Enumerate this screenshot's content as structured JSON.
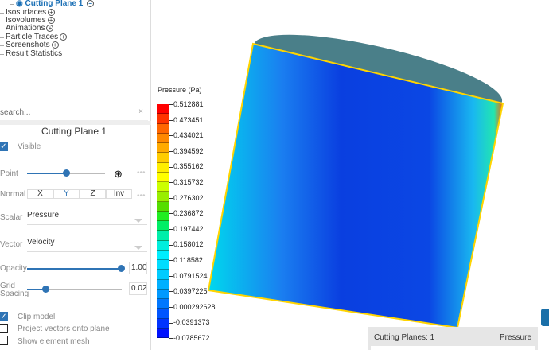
{
  "tree": {
    "active": "Cutting Plane 1",
    "items": [
      "Isosurfaces",
      "Isovolumes",
      "Animations",
      "Particle Traces",
      "Screenshots",
      "Result Statistics"
    ]
  },
  "search": {
    "placeholder": "search..."
  },
  "panel": {
    "title": "Cutting Plane 1",
    "visible": "Visible",
    "point": "Point",
    "normal": "Normal",
    "normal_options": [
      "X",
      "Y",
      "Z",
      "Inv"
    ],
    "normal_selected": "Y",
    "scalar_label": "Scalar",
    "scalar_value": "Pressure",
    "vector_label": "Vector",
    "vector_value": "Velocity",
    "opacity_label": "Opacity",
    "opacity_value": "1.00",
    "opacity": 1.0,
    "grid_label1": "Grid",
    "grid_label2": "Spacing",
    "grid_value": "0.020",
    "grid_fraction": 0.2,
    "point_fraction": 0.5,
    "clip_model": "Clip model",
    "project_vectors": "Project vectors onto plane",
    "show_mesh": "Show element mesh",
    "checks": {
      "visible": true,
      "clip_model": true,
      "project_vectors": false,
      "show_mesh": false
    }
  },
  "legend": {
    "title": "Pressure (Pa)",
    "ticks": [
      "0.512881",
      "0.473451",
      "0.434021",
      "0.394592",
      "0.355162",
      "0.315732",
      "0.276302",
      "0.236872",
      "0.197442",
      "0.158012",
      "0.118582",
      "0.0791524",
      "0.0397225",
      "0.000292628",
      "-0.0391373",
      "-0.0785672"
    ],
    "colors": [
      "#ff0000",
      "#ff3300",
      "#ff6600",
      "#ff8800",
      "#ffaa00",
      "#ffcc00",
      "#ffee00",
      "#ffff00",
      "#ccff00",
      "#99ee00",
      "#55dd00",
      "#22ee22",
      "#00ee66",
      "#00eeaa",
      "#00eedd",
      "#00eeff",
      "#00ddff",
      "#00ccff",
      "#00b0ff",
      "#0099ff",
      "#0077ff",
      "#0055ff",
      "#0033ff",
      "#0011ff"
    ]
  },
  "status": {
    "cutting_planes": "Cutting Planes: 1",
    "scalar": "Pressure"
  }
}
